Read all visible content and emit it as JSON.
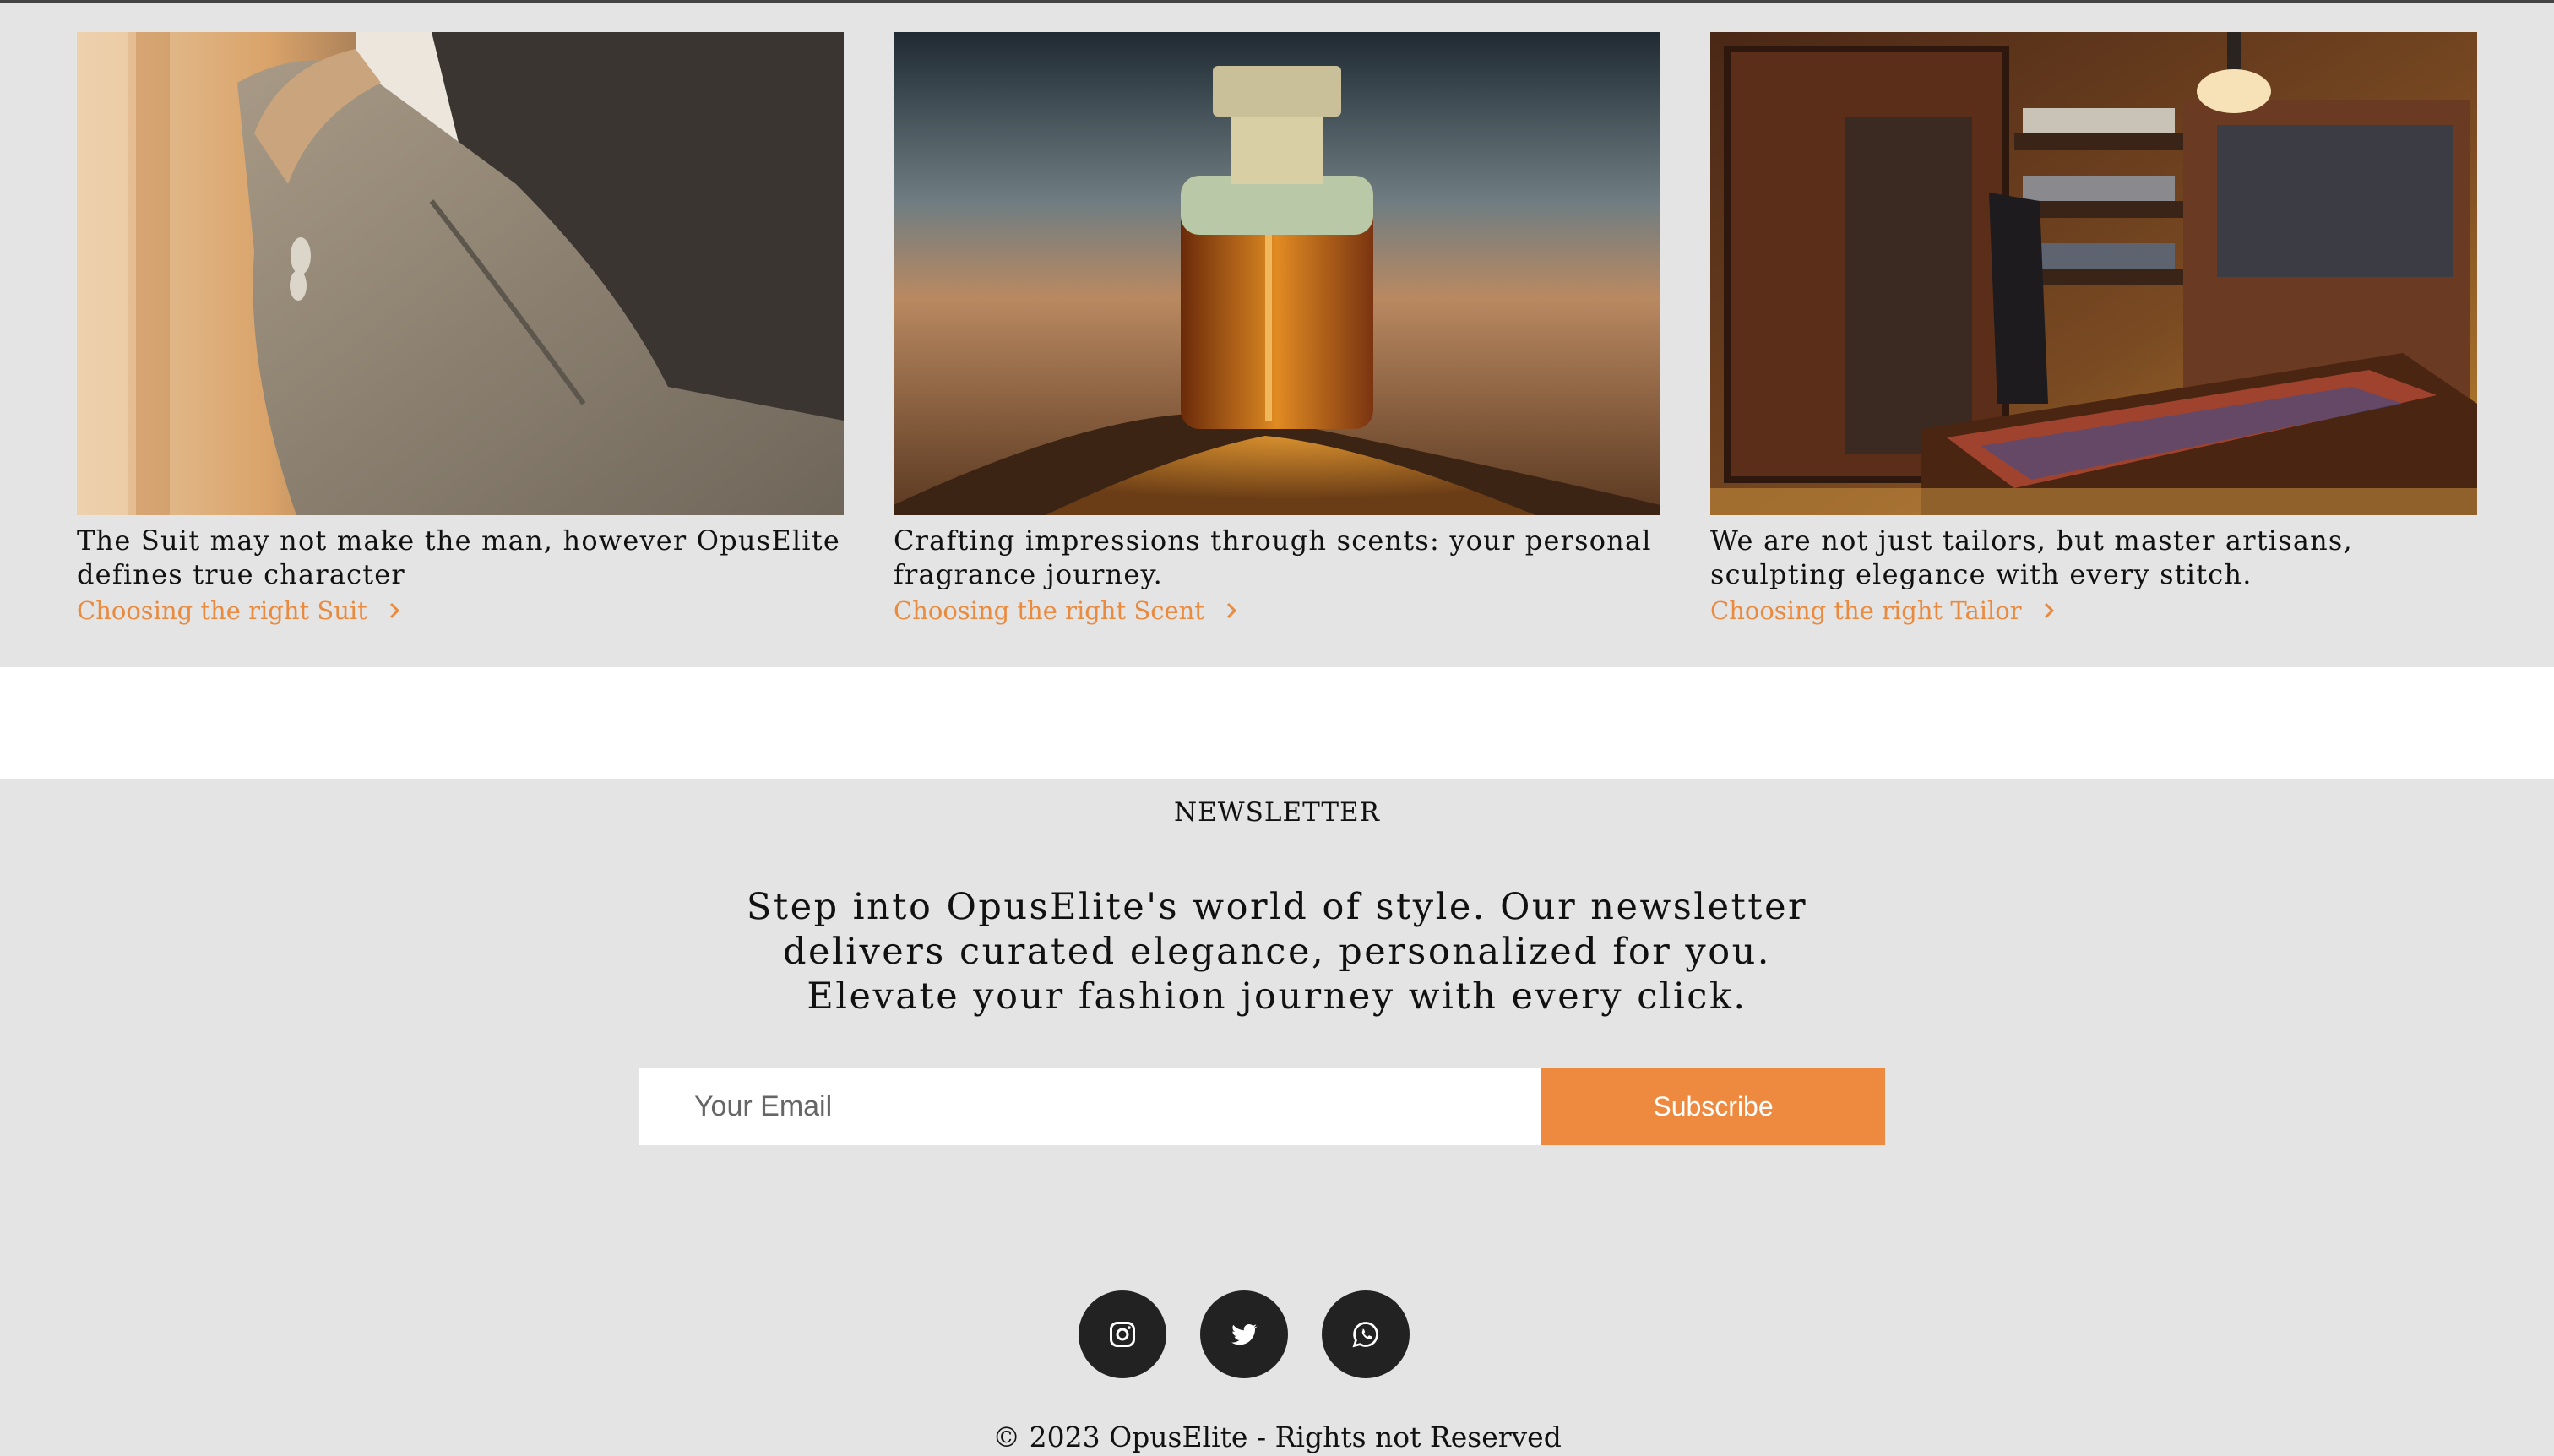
{
  "cards": [
    {
      "caption": "The Suit may not make the man, however OpusElite defines true character",
      "link": "Choosing the right Suit",
      "image": "man-in-suit-photo"
    },
    {
      "caption": "Crafting impressions through scents: your personal fragrance journey.",
      "link": "Choosing the right Scent",
      "image": "perfume-bottle-photo"
    },
    {
      "caption": "We are not just tailors, but master artisans, sculpting elegance with every stitch.",
      "link": "Choosing the right Tailor",
      "image": "tailor-shop-photo"
    }
  ],
  "newsletter": {
    "heading": "NEWSLETTER",
    "text": "Step into OpusElite's world of style. Our newsletter delivers curated elegance, personalized for you. Elevate your fashion journey with every click.",
    "email_placeholder": "Your Email",
    "email_value": "",
    "subscribe_label": "Subscribe"
  },
  "social": [
    "instagram-icon",
    "twitter-icon",
    "whatsapp-icon"
  ],
  "footer": {
    "copyright": "© 2023 OpusElite - Rights not Reserved"
  },
  "colors": {
    "accent": "#ee8a3f",
    "background": "#e4e4e4",
    "social_bg": "#222222"
  }
}
